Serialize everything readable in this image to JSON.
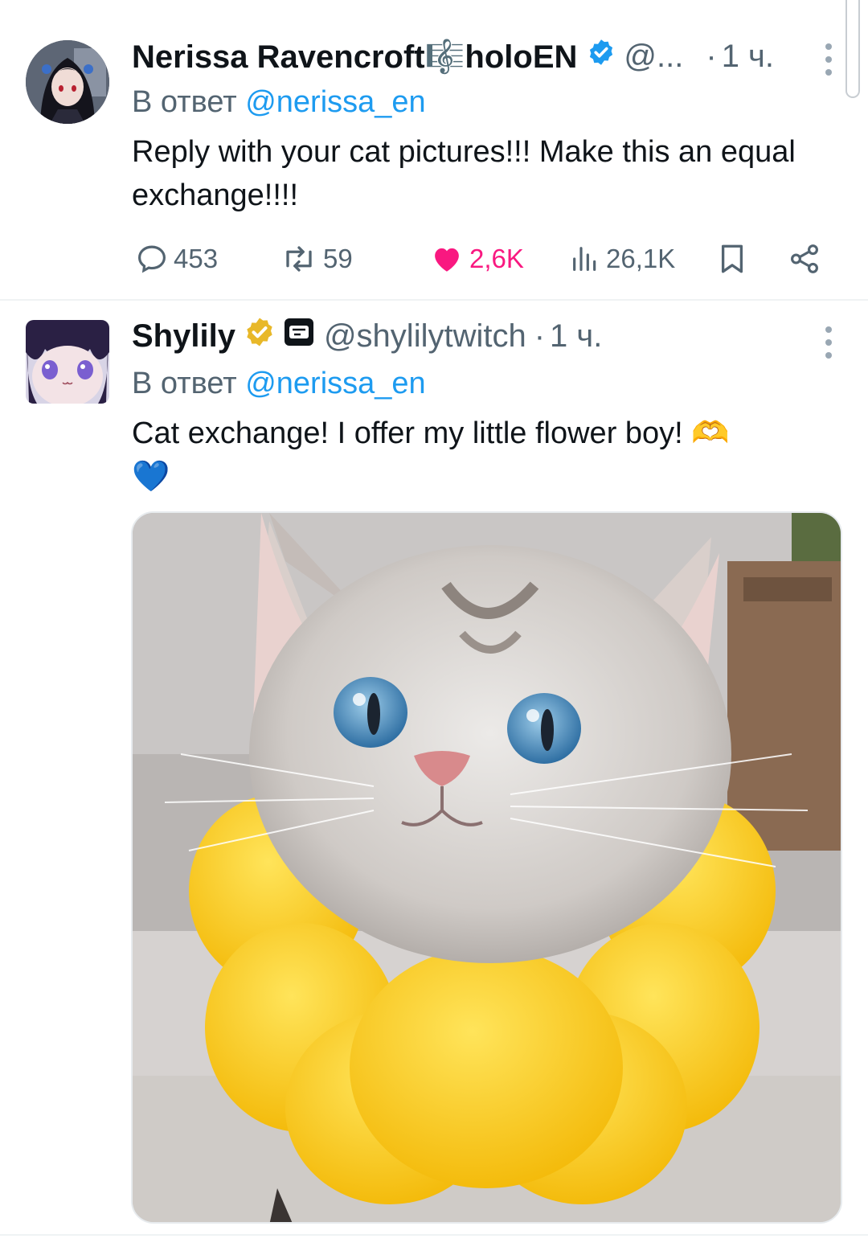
{
  "colors": {
    "text_primary": "#0f1419",
    "text_secondary": "#536471",
    "link_blue": "#1d9bf0",
    "like_pink": "#f91880",
    "verified_blue": "#1d9bf0",
    "verified_gold": "#e8b829"
  },
  "tweets": [
    {
      "author_name": "Nerissa Ravencroft🎼holoEN",
      "handle": "@...",
      "separator": "·",
      "time": "1 ч.",
      "verified": "blue",
      "reply_prefix": "В ответ",
      "reply_mention": "@nerissa_en",
      "text": "Reply with your cat pictures!!! Make this an equal exchange!!!!",
      "stats": {
        "replies": "453",
        "reposts": "59",
        "likes": "2,6K",
        "views": "26,1K"
      },
      "icons": [
        "reply-icon",
        "repost-icon",
        "like-icon",
        "views-icon",
        "bookmark-icon",
        "share-icon"
      ]
    },
    {
      "author_name": "Shylily",
      "handle": "@shylilytwitch",
      "separator": "·",
      "time": "1 ч.",
      "verified": "gold",
      "affiliate_badge": "SS",
      "reply_prefix": "В ответ",
      "reply_mention": "@nerissa_en",
      "text_line1": "Cat exchange! I offer my little flower boy! 🫶",
      "text_line2": "💙",
      "media": "photo of a grey tabby cat with blue eyes wearing a yellow plush flower collar"
    }
  ]
}
